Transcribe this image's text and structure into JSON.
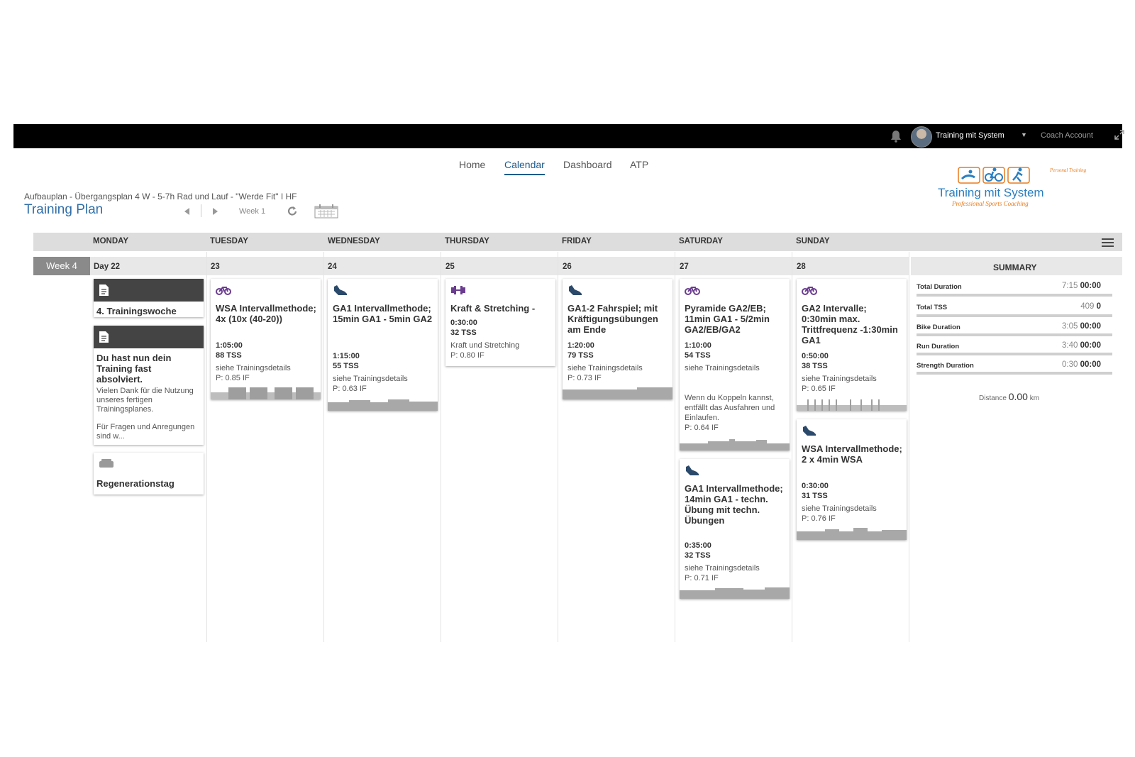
{
  "topbar": {
    "user_name": "Training mit System",
    "coach_account": "Coach Account"
  },
  "nav": [
    "Home",
    "Calendar",
    "Dashboard",
    "ATP"
  ],
  "plan": {
    "subtitle": "Aufbauplan - Übergangsplan 4 W - 5-7h Rad und Lauf - \"Werde Fit\" I HF",
    "title": "Training Plan",
    "week_label": "Week 1"
  },
  "logo": {
    "line1": "Training mit System",
    "line2": "Professional Sports Coaching",
    "tag": "Personal Training"
  },
  "calendar": {
    "days": [
      "MONDAY",
      "TUESDAY",
      "WEDNESDAY",
      "THURSDAY",
      "FRIDAY",
      "SATURDAY",
      "SUNDAY"
    ],
    "week_label": "Week 4",
    "dates": [
      "Day 22",
      "23",
      "24",
      "25",
      "26",
      "27",
      "28"
    ],
    "summary_label": "SUMMARY"
  },
  "monday": {
    "note1": "4. Trainingswoche",
    "note2_title": "Du hast nun dein Training fast absolviert.",
    "note2_text": "Vielen Dank für die Nutzung unseres fertigen Trainingsplanes.",
    "note2_text2": "Für Fragen und Anregungen sind w...",
    "rest": "Regenerationstag"
  },
  "workouts": {
    "tue": {
      "title": "WSA Intervallmethode; 4x (10x (40-20))",
      "duration": "1:05:00",
      "tss": "88 TSS",
      "desc": "siehe Trainingsdetails",
      "if": "P: 0.85 IF"
    },
    "wed": {
      "title": "GA1 Intervallmethode; 15min GA1 - 5min GA2",
      "duration": "1:15:00",
      "tss": "55 TSS",
      "desc": "siehe Trainingsdetails",
      "if": "P: 0.63 IF"
    },
    "thu": {
      "title": "Kraft & Stretching -",
      "duration": "0:30:00",
      "tss": "32 TSS",
      "desc": "Kraft und Stretching",
      "if": "P: 0.80 IF"
    },
    "fri": {
      "title": "GA1-2 Fahrspiel; mit Kräftigungsübungen am Ende",
      "duration": "1:20:00",
      "tss": "79 TSS",
      "desc": "siehe Trainingsdetails",
      "if": "P: 0.73 IF"
    },
    "sat1": {
      "title": "Pyramide GA2/EB; 11min GA1 - 5/2min GA2/EB/GA2",
      "duration": "1:10:00",
      "tss": "54 TSS",
      "desc": "siehe Trainingsdetails",
      "desc2": "Wenn du Koppeln kannst, entfällt das Ausfahren und Einlaufen.",
      "if": "P: 0.64 IF"
    },
    "sat2": {
      "title": "GA1 Intervallmethode; 14min GA1 - techn. Übung mit techn. Übungen",
      "duration": "0:35:00",
      "tss": "32 TSS",
      "desc": "siehe Trainingsdetails",
      "if": "P: 0.71 IF"
    },
    "sun1": {
      "title": "GA2 Intervalle; 0:30min max. Trittfrequenz -1:30min GA1",
      "duration": "0:50:00",
      "tss": "38 TSS",
      "desc": "siehe Trainingsdetails",
      "if": "P: 0.65 IF"
    },
    "sun2": {
      "title": "WSA Intervallmethode; 2 x 4min WSA",
      "duration": "0:30:00",
      "tss": "31 TSS",
      "desc": "siehe Trainingsdetails",
      "if": "P: 0.76 IF"
    }
  },
  "summary": {
    "rows": [
      {
        "label": "Total Duration",
        "planned": "7:15",
        "done": "00:00"
      },
      {
        "label": "Total TSS",
        "planned": "409",
        "done": "0"
      },
      {
        "label": "Bike Duration",
        "planned": "3:05",
        "done": "00:00"
      },
      {
        "label": "Run Duration",
        "planned": "3:40",
        "done": "00:00"
      },
      {
        "label": "Strength Duration",
        "planned": "0:30",
        "done": "00:00"
      }
    ],
    "distance_label": "Distance",
    "distance_value": "0.00",
    "distance_unit": "km"
  },
  "colors": {
    "accent": "#1e5a8c",
    "bike": "#6b3d8f",
    "run": "#2b4a6b",
    "strength": "#6b3d8f"
  }
}
